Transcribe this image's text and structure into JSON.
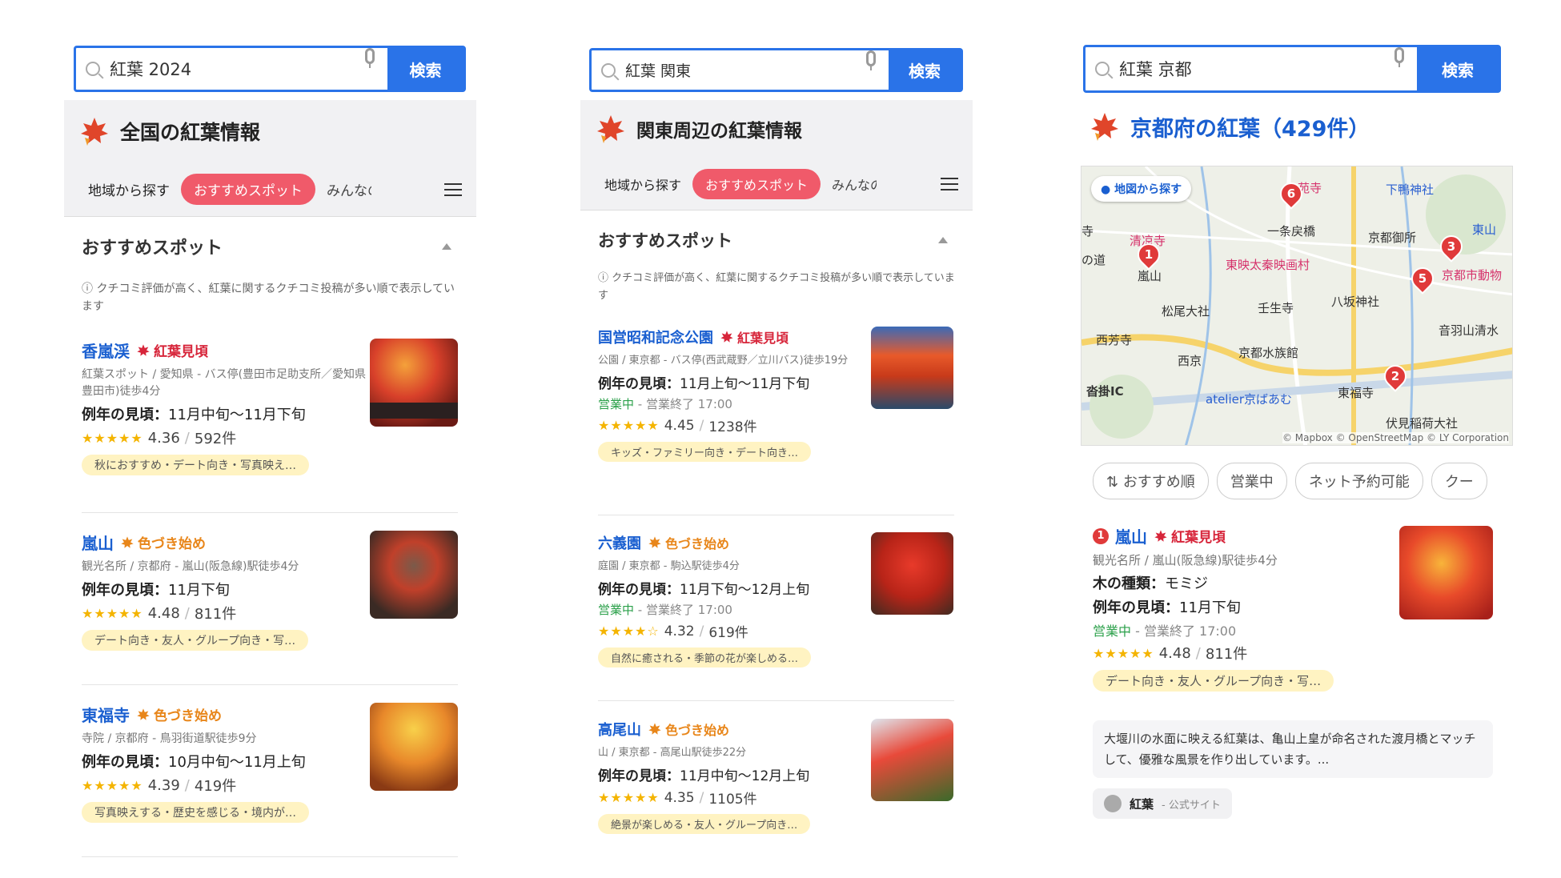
{
  "colors": {
    "brand_blue": "#2a73e8",
    "link_blue": "#1a5fd0",
    "active_tab": "#f05a6a",
    "peak_red": "#d7253a",
    "start_orange": "#e8861a",
    "open_green": "#2ba04a",
    "tag_yellow": "#fff3c2"
  },
  "panel1": {
    "search": {
      "query": "紅葉 2024",
      "button": "検索"
    },
    "header": "全国の紅葉情報",
    "tabs": [
      "地域から探す",
      "おすすめスポット",
      "みんなの"
    ],
    "section": "おすすめスポット",
    "note": "クチコミ評価が高く、紅葉に関するクチコミ投稿が多い順で表示しています",
    "spots": [
      {
        "name": "香嵐渓",
        "status": "紅葉見頃",
        "meta": "紅葉スポット / 愛知県 - バス停(豊田市足助支所／愛知県豊田市)徒歩4分",
        "peak_label": "例年の見頃：",
        "peak": "11月中旬〜11月下旬",
        "stars": "★★★★★",
        "rating": "4.36",
        "count": "592件",
        "tags": "秋におすすめ・デート向き・写真映え…"
      },
      {
        "name": "嵐山",
        "status": "色づき始め",
        "meta": "観光名所 / 京都府 - 嵐山(阪急線)駅徒歩4分",
        "peak_label": "例年の見頃：",
        "peak": "11月下旬",
        "stars": "★★★★★",
        "rating": "4.48",
        "count": "811件",
        "tags": "デート向き・友人・グループ向き・写…"
      },
      {
        "name": "東福寺",
        "status": "色づき始め",
        "meta": "寺院 / 京都府 - 鳥羽街道駅徒歩9分",
        "peak_label": "例年の見頃：",
        "peak": "10月中旬〜11月上旬",
        "stars": "★★★★★",
        "rating": "4.39",
        "count": "419件",
        "tags": "写真映えする・歴史を感じる・境内が…"
      }
    ]
  },
  "panel2": {
    "search": {
      "query": "紅葉 関東",
      "button": "検索"
    },
    "header": "関東周辺の紅葉情報",
    "tabs": [
      "地域から探す",
      "おすすめスポット",
      "みんなの"
    ],
    "section": "おすすめスポット",
    "note": "クチコミ評価が高く、紅葉に関するクチコミ投稿が多い順で表示しています",
    "spots": [
      {
        "name": "国営昭和記念公園",
        "status": "紅葉見頃",
        "meta": "公園 / 東京都 - バス停(西武蔵野／立川バス)徒歩19分",
        "peak_label": "例年の見頃：",
        "peak": "11月上旬〜11月下旬",
        "open": "営業中",
        "close": "営業終了 17:00",
        "stars": "★★★★★",
        "rating": "4.45",
        "count": "1238件",
        "tags": "キッズ・ファミリー向き・デート向き…"
      },
      {
        "name": "六義園",
        "status": "色づき始め",
        "meta": "庭園 / 東京都 - 駒込駅徒歩4分",
        "peak_label": "例年の見頃：",
        "peak": "11月下旬〜12月上旬",
        "open": "営業中",
        "close": "営業終了 17:00",
        "stars": "★★★★☆",
        "rating": "4.32",
        "count": "619件",
        "tags": "自然に癒される・季節の花が楽しめる…"
      },
      {
        "name": "高尾山",
        "status": "色づき始め",
        "meta": "山 / 東京都 - 高尾山駅徒歩22分",
        "peak_label": "例年の見頃：",
        "peak": "11月中旬〜12月上旬",
        "stars": "★★★★★",
        "rating": "4.35",
        "count": "1105件",
        "tags": "絶景が楽しめる・友人・グループ向き…"
      }
    ]
  },
  "panel3": {
    "search": {
      "query": "紅葉 京都",
      "button": "検索"
    },
    "header": "京都府の紅葉（429件）",
    "map": {
      "button": "地図から探す",
      "copyright": "© Mapbox © OpenStreetMap © LY Corporation",
      "labels": [
        "苑寺",
        "下鴨神社",
        "清凉寺",
        "一条戻橋",
        "京都御所",
        "東山",
        "嵐山",
        "東映太秦映画村",
        "京都市動物",
        "松尾大社",
        "壬生寺",
        "八坂神社",
        "西芳寺",
        "西京",
        "京都水族館",
        "音羽山清水",
        "沓掛IC",
        "atelier京ばあむ",
        "東福寺",
        "伏見稲荷大社",
        "の道",
        "寺"
      ],
      "pins": [
        "1",
        "2",
        "3",
        "5",
        "6"
      ]
    },
    "chips": [
      "おすすめ順",
      "営業中",
      "ネット予約可能",
      "クー"
    ],
    "spot": {
      "rank": "1",
      "name": "嵐山",
      "status": "紅葉見頃",
      "meta": "観光名所 / 嵐山(阪急線)駅徒歩4分",
      "tree_label": "木の種類：",
      "tree": "モミジ",
      "peak_label": "例年の見頃：",
      "peak": "11月下旬",
      "open": "営業中",
      "close": "営業終了 17:00",
      "stars": "★★★★★",
      "rating": "4.48",
      "count": "811件",
      "tags": "デート向き・友人・グループ向き・写…"
    },
    "description": "大堰川の水面に映える紅葉は、亀山上皇が命名された渡月橋とマッチして、優雅な風景を作り出しています。...",
    "site": {
      "name": "紅葉",
      "label": "公式サイト"
    }
  }
}
